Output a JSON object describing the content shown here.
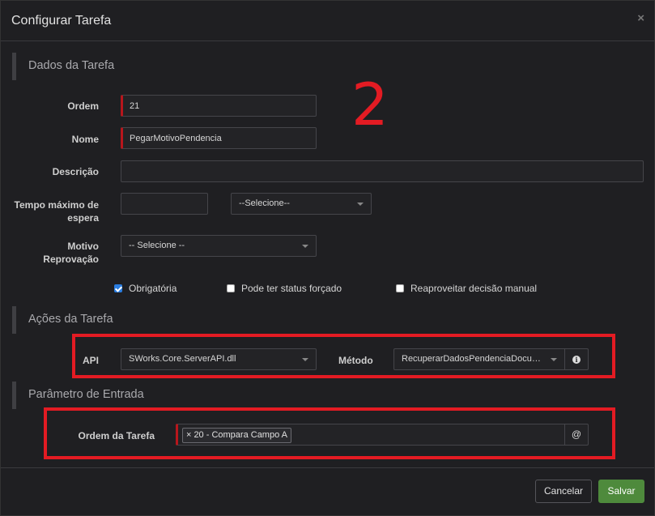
{
  "title": "Configurar Tarefa",
  "close_glyph": "×",
  "sections": {
    "dados": "Dados da Tarefa",
    "acoes": "Ações da Tarefa",
    "parametro": "Parâmetro de Entrada"
  },
  "fields": {
    "ordem": {
      "label": "Ordem",
      "value": "21"
    },
    "nome": {
      "label": "Nome",
      "value": "PegarMotivoPendencia"
    },
    "descricao": {
      "label": "Descrição",
      "value": ""
    },
    "tempo": {
      "label_line1": "Tempo máximo de",
      "label_line2": "espera",
      "value": "",
      "unit_select": "--Selecione--"
    },
    "motivo": {
      "label_line1": "Motivo",
      "label_line2": "Reprovação",
      "select": "-- Selecione --"
    }
  },
  "checkboxes": {
    "obrigatoria": {
      "label": "Obrigatória",
      "checked": true
    },
    "status_forcado": {
      "label": "Pode ter status forçado",
      "checked": false
    },
    "reaproveitar": {
      "label": "Reaproveitar decisão manual",
      "checked": false
    }
  },
  "acoes": {
    "api_label": "API",
    "api_value": "SWorks.Core.ServerAPI.dll",
    "metodo_label": "Método",
    "metodo_value": "RecuperarDadosPendenciaDocumento",
    "info_glyph": "i"
  },
  "parametro": {
    "ordem_label": "Ordem da Tarefa",
    "tag_remove": "×",
    "tag_text": "20 - Compara Campo A",
    "at_glyph": "@"
  },
  "annotation_number": "2",
  "buttons": {
    "cancel": "Cancelar",
    "save": "Salvar"
  },
  "colors": {
    "annotation_red": "#e31b23",
    "required_marker": "#b8161c",
    "save_green": "#4e8a3c",
    "checkbox_blue": "#2a7de1"
  }
}
